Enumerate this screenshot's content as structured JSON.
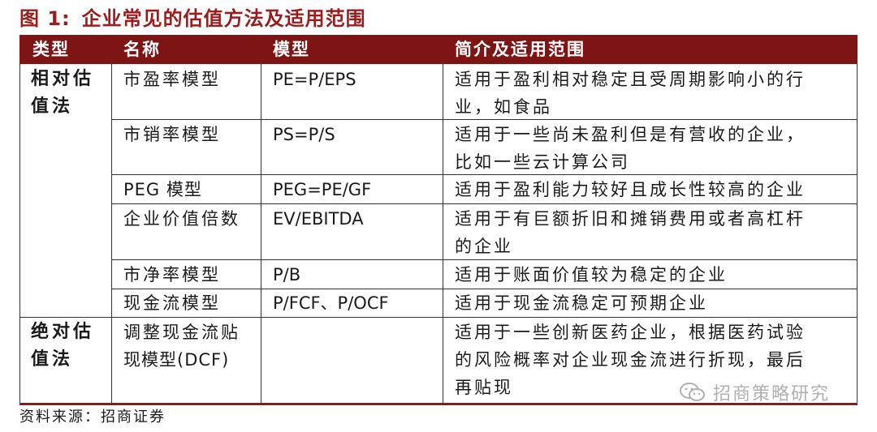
{
  "figure": {
    "number": "图 1:",
    "title": "企业常见的估值方法及适用范围"
  },
  "table": {
    "headers": [
      "类型",
      "名称",
      "模型",
      "简介及适用范围"
    ],
    "groups": [
      {
        "type_line1": "相对估",
        "type_line2": "值法"
      },
      {
        "type_line1": "绝对估",
        "type_line2": "值法"
      }
    ],
    "rows": [
      {
        "name": "市盈率模型",
        "model": "PE=P/EPS",
        "desc_line1": "适用于盈利相对稳定且受周期影响小的行",
        "desc_line2": "业，如食品"
      },
      {
        "name": "市销率模型",
        "model": "PS=P/S",
        "desc_line1": "适用于一些尚未盈利但是有营收的企业，",
        "desc_line2": "比如一些云计算公司"
      },
      {
        "name": "PEG 模型",
        "model": "PEG=PE/GF",
        "desc_line1": "适用于盈利能力较好且成长性较高的企业",
        "desc_line2": ""
      },
      {
        "name": "企业价值倍数",
        "model": "EV/EBITDA",
        "desc_line1": "适用于有巨额折旧和摊销费用或者高杠杆",
        "desc_line2": "的企业"
      },
      {
        "name": "市净率模型",
        "model": "P/B",
        "desc_line1": "适用于账面价值较为稳定的企业",
        "desc_line2": ""
      },
      {
        "name": "现金流模型",
        "model": "P/FCF、P/OCF",
        "desc_line1": "适用于现金流稳定可预期企业",
        "desc_line2": ""
      },
      {
        "name_line1": "调整现金流贴",
        "name_line2": "现模型(DCF)",
        "model": "",
        "desc_line1": "适用于一些创新医药企业，根据医药试验",
        "desc_line2": "的风险概率对企业现金流进行折现，最后",
        "desc_line3": "再贴现"
      }
    ]
  },
  "source": "资料来源：招商证券",
  "watermark": {
    "text": "招商策略研究",
    "icon": "wechat-icon"
  },
  "colors": {
    "title": "#9b1c1c",
    "header_bg": "#7e1515",
    "header_text": "#ffffff",
    "watermark": "#b0b0b0"
  }
}
